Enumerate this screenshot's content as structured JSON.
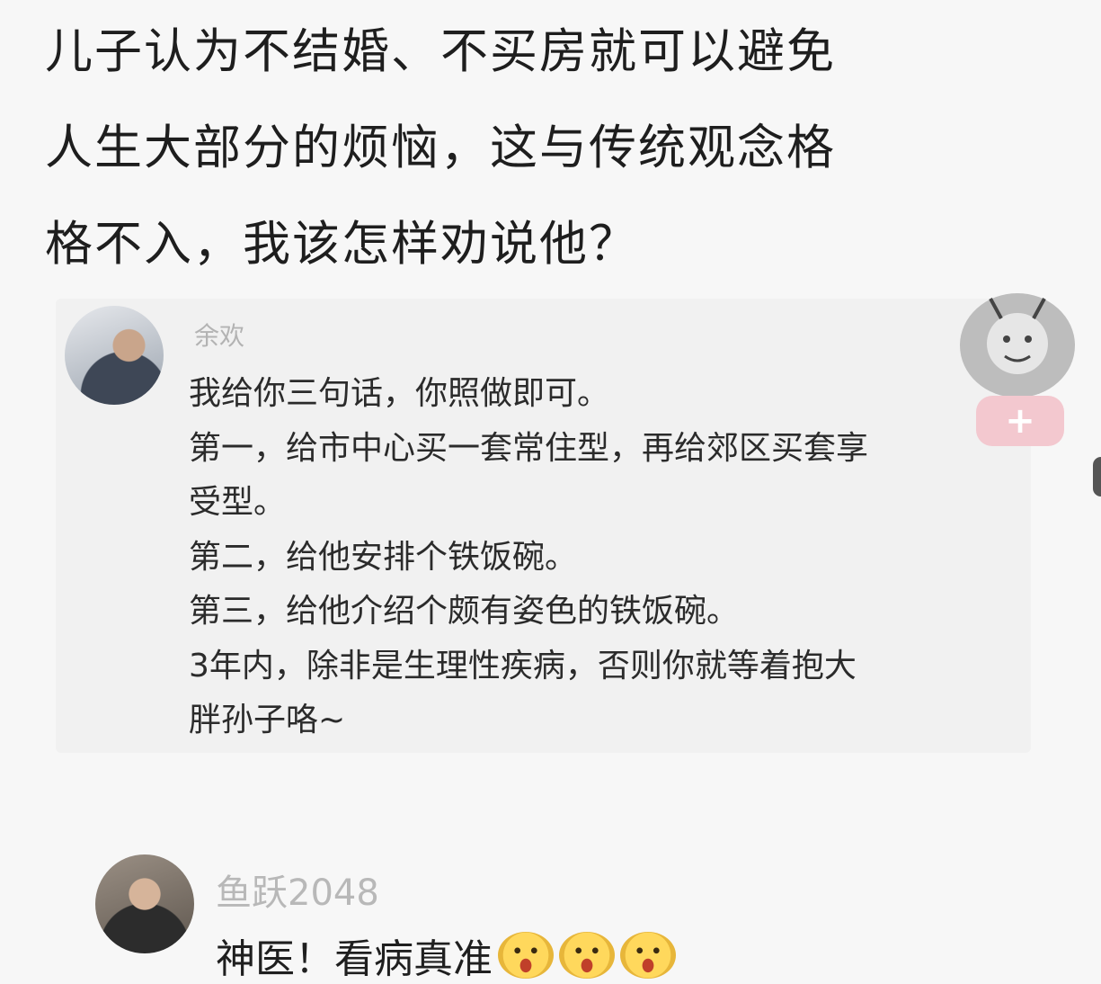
{
  "post": {
    "question_lines": [
      "儿子认为不结婚、不买房就可以避免",
      "人生大部分的烦恼，这与传统观念格",
      "格不入，我该怎样劝说他？"
    ]
  },
  "reply1": {
    "username": "余欢",
    "avatar_icon": "man-portrait-avatar",
    "lines": [
      "我给你三句话，你照做即可。",
      "第一，给市中心买一套常住型，再给郊区买套享",
      "受型。",
      "第二，给他安排个铁饭碗。",
      "第三，给他介绍个颇有姿色的铁饭碗。",
      "3年内，除非是生理性疾病，否则你就等着抱大",
      "胖孙子咯~"
    ]
  },
  "reply2": {
    "username": "鱼跃2048",
    "avatar_icon": "man-with-glasses-avatar",
    "text": "神医！看病真准",
    "emojis": [
      "grinning-face-emoji",
      "grinning-face-emoji",
      "grinning-face-emoji"
    ]
  },
  "sticker": {
    "icon": "meme-sticker-icon",
    "add_label": "+"
  }
}
